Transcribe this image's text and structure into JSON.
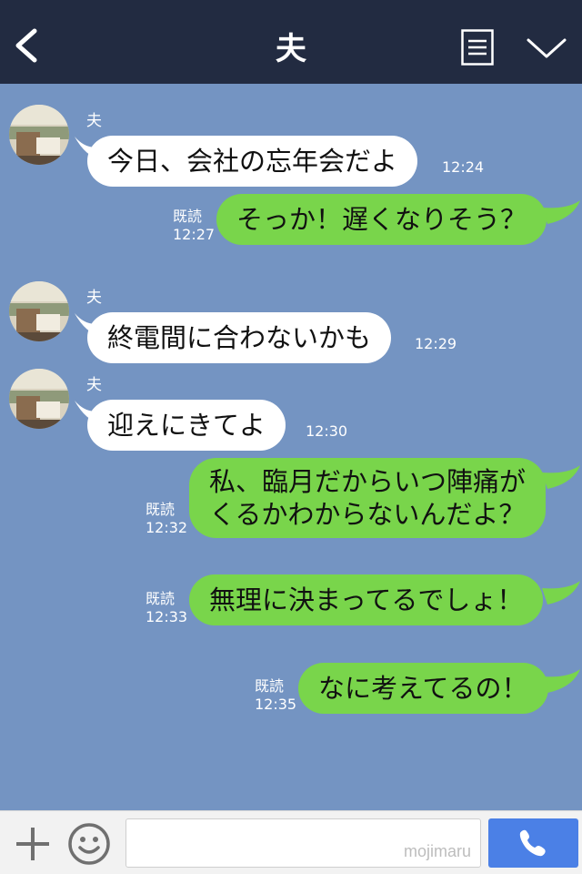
{
  "header": {
    "title": "夫"
  },
  "messages": [
    {
      "sender": "夫",
      "text": "今日、会社の忘年会だよ",
      "time": "12:24"
    },
    {
      "text": "そっか！遅くなりそう？",
      "read": "既読",
      "time": "12:27"
    },
    {
      "sender": "夫",
      "text": "終電間に合わないかも",
      "time": "12:29"
    },
    {
      "sender": "夫",
      "text": "迎えにきてよ",
      "time": "12:30"
    },
    {
      "text_line1": "私、臨月だからいつ陣痛が",
      "text_line2": "くるかわからないんだよ？",
      "read": "既読",
      "time": "12:32"
    },
    {
      "text": "無理に決まってるでしょ！",
      "read": "既読",
      "time": "12:33"
    },
    {
      "text": "なに考えてるの！",
      "read": "既読",
      "time": "12:35"
    }
  ],
  "footer": {
    "watermark": "mojimaru"
  },
  "colors": {
    "header_bg": "#222b41",
    "chat_bg": "#7494c2",
    "outgoing_bubble": "#79d54b",
    "incoming_bubble": "#ffffff",
    "call_button": "#4b80e6"
  },
  "icons": [
    "back-chevron-icon",
    "menu-list-icon",
    "chevron-down-icon",
    "plus-icon",
    "smiley-icon",
    "phone-icon"
  ]
}
